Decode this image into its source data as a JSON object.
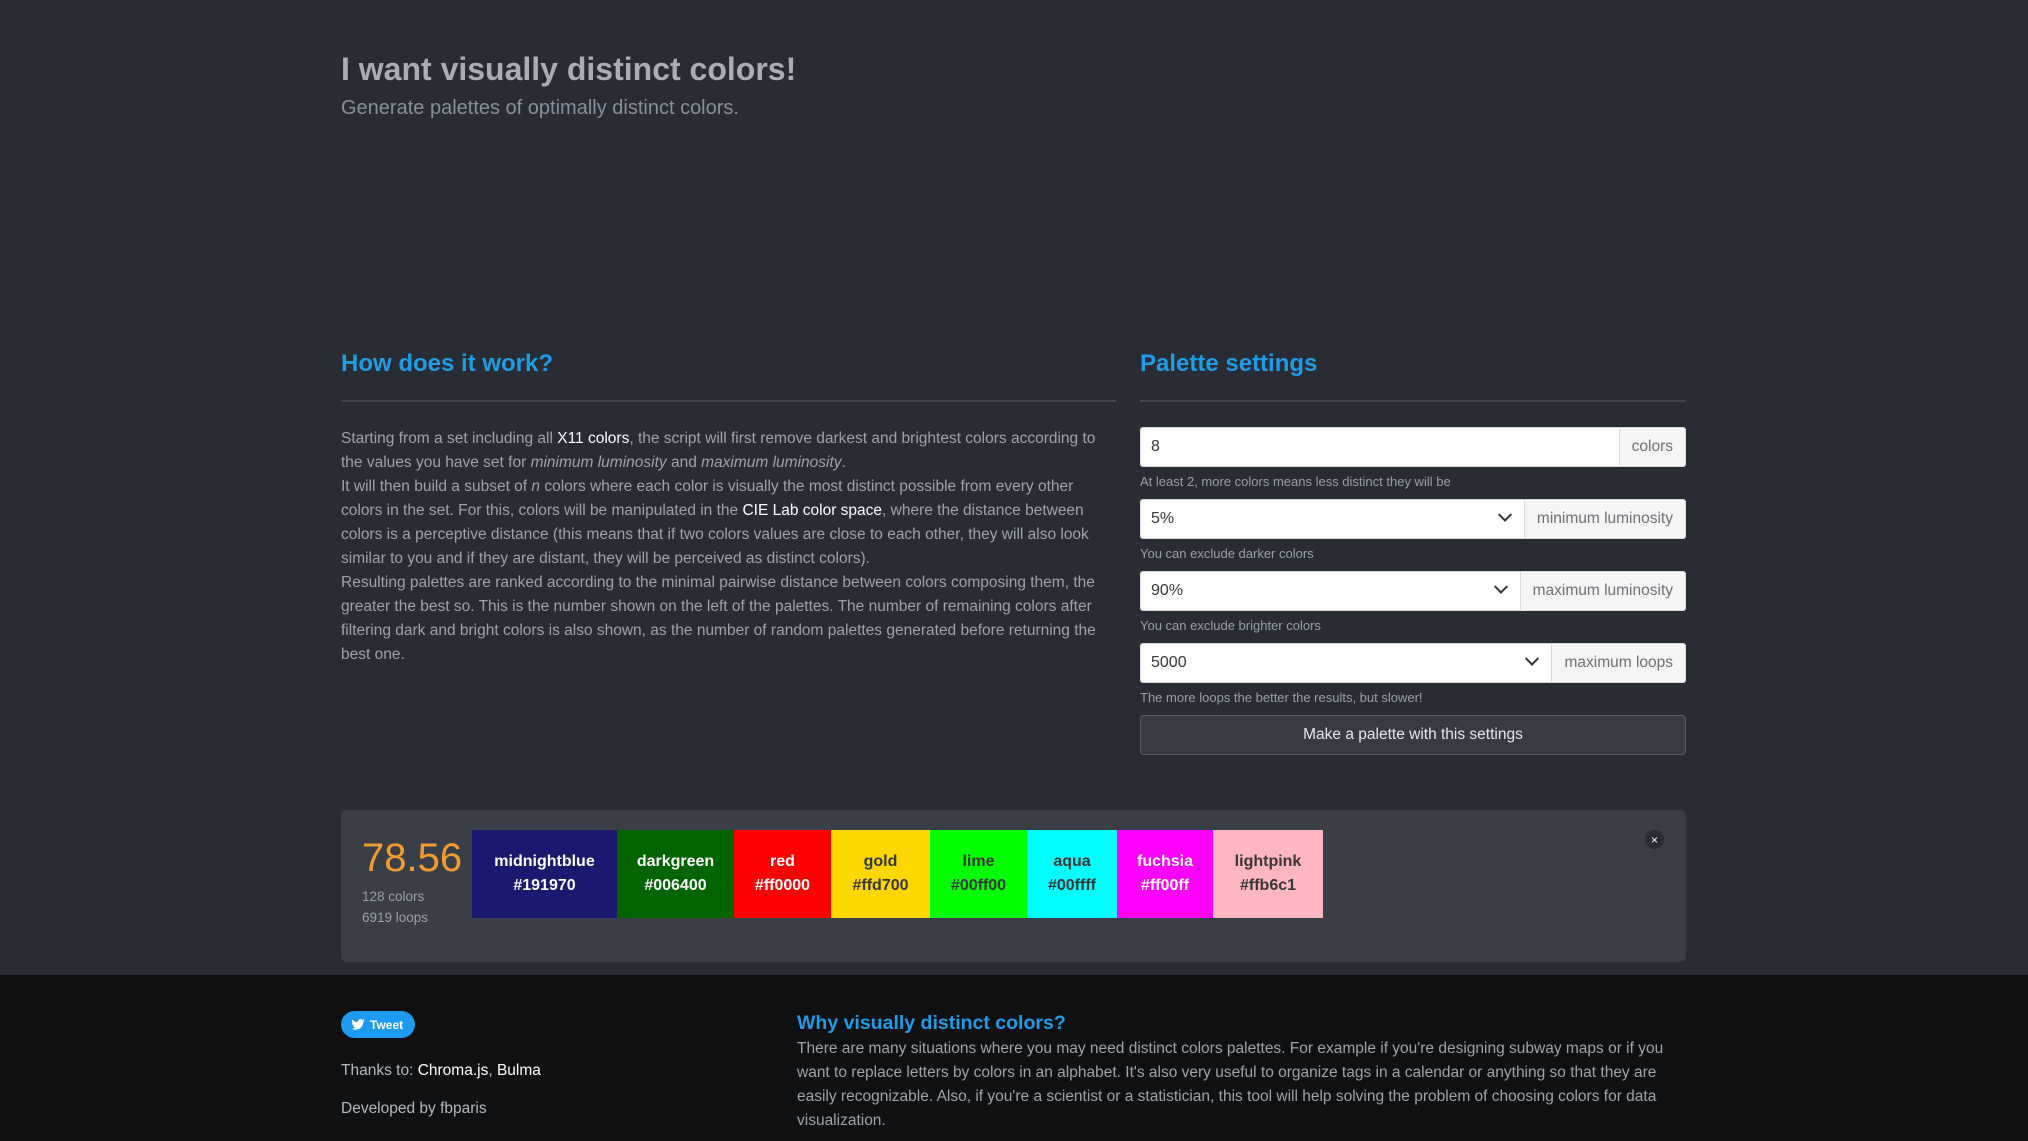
{
  "hero": {
    "title": "I want visually distinct colors!",
    "subtitle": "Generate palettes of optimally distinct colors."
  },
  "about": {
    "title": "How does it work?",
    "p1_a": "Starting from a set including all ",
    "p1_link": "X11 colors",
    "p1_b": ", the script will first remove darkest and brightest colors according to the values you have set for ",
    "p1_em1": "minimum luminosity",
    "p1_c": " and ",
    "p1_em2": "maximum luminosity",
    "p1_d": ".",
    "p2_a": "It will then build a subset of ",
    "p2_em": "n",
    "p2_b": " colors where each color is visually the most distinct possible from every other colors in the set. For this, colors will be manipulated in the ",
    "p2_link": "CIE Lab color space",
    "p2_c": ", where the distance between colors is a perceptive distance (this means that if two colors values are close to each other, they will also look similar to you and if they are distant, they will be perceived as distinct colors).",
    "p3": "Resulting palettes are ranked according to the minimal pairwise distance between colors composing them, the greater the best so. This is the number shown on the left of the palettes. The number of remaining colors after filtering dark and bright colors is also shown, as the number of random palettes generated before returning the best one."
  },
  "settings": {
    "title": "Palette settings",
    "colors_value": "8",
    "colors_addon": "colors",
    "colors_help": "At least 2, more colors means less distinct they will be",
    "min_lum_value": "5%",
    "min_lum_addon": "minimum luminosity",
    "min_lum_help": "You can exclude darker colors",
    "max_lum_value": "90%",
    "max_lum_addon": "maximum luminosity",
    "max_lum_help": "You can exclude brighter colors",
    "loops_value": "5000",
    "loops_addon": "maximum loops",
    "loops_help": "The more loops the better the results, but slower!",
    "submit_label": "Make a palette with this settings"
  },
  "result": {
    "score": "78.56",
    "colors_count": "128 colors",
    "loops_count": "6919 loops",
    "close_label": "×",
    "swatches": [
      {
        "name": "midnightblue",
        "hex": "#191970",
        "text": "#ffffff"
      },
      {
        "name": "darkgreen",
        "hex": "#006400",
        "text": "#ffffff"
      },
      {
        "name": "red",
        "hex": "#ff0000",
        "text": "#ffffff"
      },
      {
        "name": "gold",
        "hex": "#ffd700",
        "text": "#363636"
      },
      {
        "name": "lime",
        "hex": "#00ff00",
        "text": "#363636"
      },
      {
        "name": "aqua",
        "hex": "#00ffff",
        "text": "#363636"
      },
      {
        "name": "fuchsia",
        "hex": "#ff00ff",
        "text": "#ffffff"
      },
      {
        "name": "lightpink",
        "hex": "#ffb6c1",
        "text": "#363636"
      }
    ]
  },
  "footer": {
    "tweet_label": "Tweet",
    "thanks_prefix": "Thanks to: ",
    "thanks_link1": "Chroma.js",
    "thanks_sep": ", ",
    "thanks_link2": "Bulma",
    "developed_by": "Developed by fbparis",
    "why_title": "Why visually distinct colors?",
    "why_text": "There are many situations where you may need distinct colors palettes. For example if you're designing subway maps or if you want to replace letters by colors in an alphabet. It's also very useful to organize tags in a calendar or anything so that they are easily recognizable. Also, if you're a scientist or a statistician, this tool will help solving the problem of choosing colors for data visualization."
  },
  "colors": {
    "background": "#282c34",
    "accent": "#1e9ce6",
    "score": "#f39c2e",
    "footer_bg": "#0f1012"
  }
}
